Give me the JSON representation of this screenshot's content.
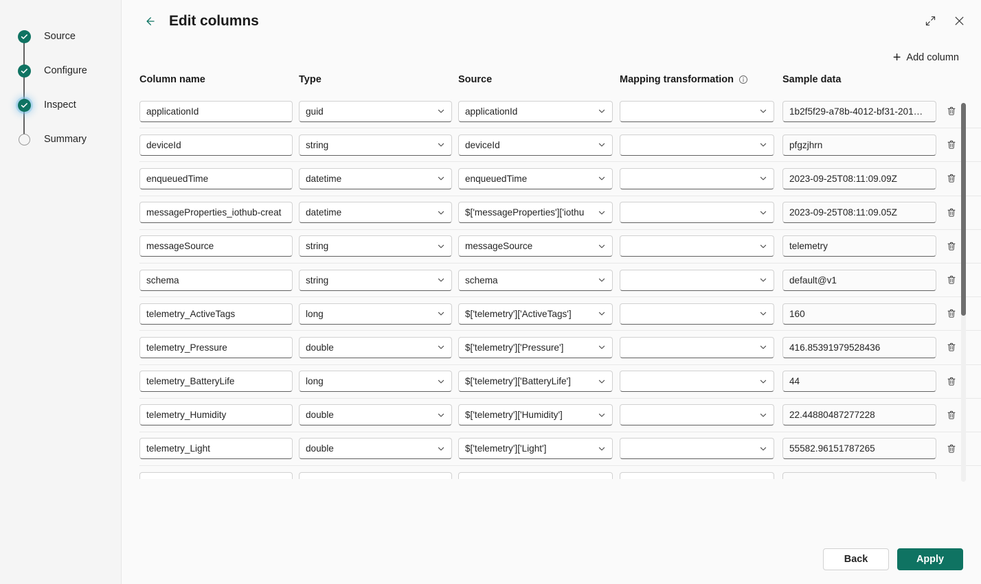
{
  "wizard": {
    "steps": [
      {
        "label": "Source",
        "state": "done"
      },
      {
        "label": "Configure",
        "state": "done"
      },
      {
        "label": "Inspect",
        "state": "done-focused"
      },
      {
        "label": "Summary",
        "state": "pending"
      }
    ]
  },
  "header": {
    "back_icon": "arrow-left-icon",
    "title": "Edit columns",
    "expand_icon": "expand-diagonal-icon",
    "close_icon": "close-icon"
  },
  "toolbar": {
    "add_column_label": "Add column",
    "add_icon": "plus-icon"
  },
  "grid": {
    "headers": {
      "column_name": "Column name",
      "type": "Type",
      "source": "Source",
      "mapping_transformation": "Mapping transformation",
      "mapping_info_icon": "info-icon",
      "sample_data": "Sample data"
    },
    "delete_icon": "trash-icon",
    "chevron_icon": "chevron-down-icon",
    "rows": [
      {
        "column_name": "applicationId",
        "type": "guid",
        "source": "applicationId",
        "mapping": "",
        "sample": "1b2f5f29-a78b-4012-bf31-201…"
      },
      {
        "column_name": "deviceId",
        "type": "string",
        "source": "deviceId",
        "mapping": "",
        "sample": "pfgzjhrn"
      },
      {
        "column_name": "enqueuedTime",
        "type": "datetime",
        "source": "enqueuedTime",
        "mapping": "",
        "sample": "2023-09-25T08:11:09.09Z"
      },
      {
        "column_name": "messageProperties_iothub-creat",
        "type": "datetime",
        "source": "$['messageProperties']['iothu",
        "mapping": "",
        "sample": "2023-09-25T08:11:09.05Z"
      },
      {
        "column_name": "messageSource",
        "type": "string",
        "source": "messageSource",
        "mapping": "",
        "sample": "telemetry"
      },
      {
        "column_name": "schema",
        "type": "string",
        "source": "schema",
        "mapping": "",
        "sample": "default@v1"
      },
      {
        "column_name": "telemetry_ActiveTags",
        "type": "long",
        "source": "$['telemetry']['ActiveTags']",
        "mapping": "",
        "sample": "160"
      },
      {
        "column_name": "telemetry_Pressure",
        "type": "double",
        "source": "$['telemetry']['Pressure']",
        "mapping": "",
        "sample": "416.85391979528436"
      },
      {
        "column_name": "telemetry_BatteryLife",
        "type": "long",
        "source": "$['telemetry']['BatteryLife']",
        "mapping": "",
        "sample": "44"
      },
      {
        "column_name": "telemetry_Humidity",
        "type": "double",
        "source": "$['telemetry']['Humidity']",
        "mapping": "",
        "sample": "22.44880487277228"
      },
      {
        "column_name": "telemetry_Light",
        "type": "double",
        "source": "$['telemetry']['Light']",
        "mapping": "",
        "sample": "55582.96151787265"
      },
      {
        "column_name": "",
        "type": "",
        "source": "",
        "mapping": "",
        "sample": ""
      }
    ]
  },
  "footer": {
    "back_label": "Back",
    "apply_label": "Apply"
  },
  "colors": {
    "accent": "#0f7362",
    "panel_bg": "#fafafa",
    "rail_bg": "#f5f5f5",
    "text": "#242424"
  }
}
